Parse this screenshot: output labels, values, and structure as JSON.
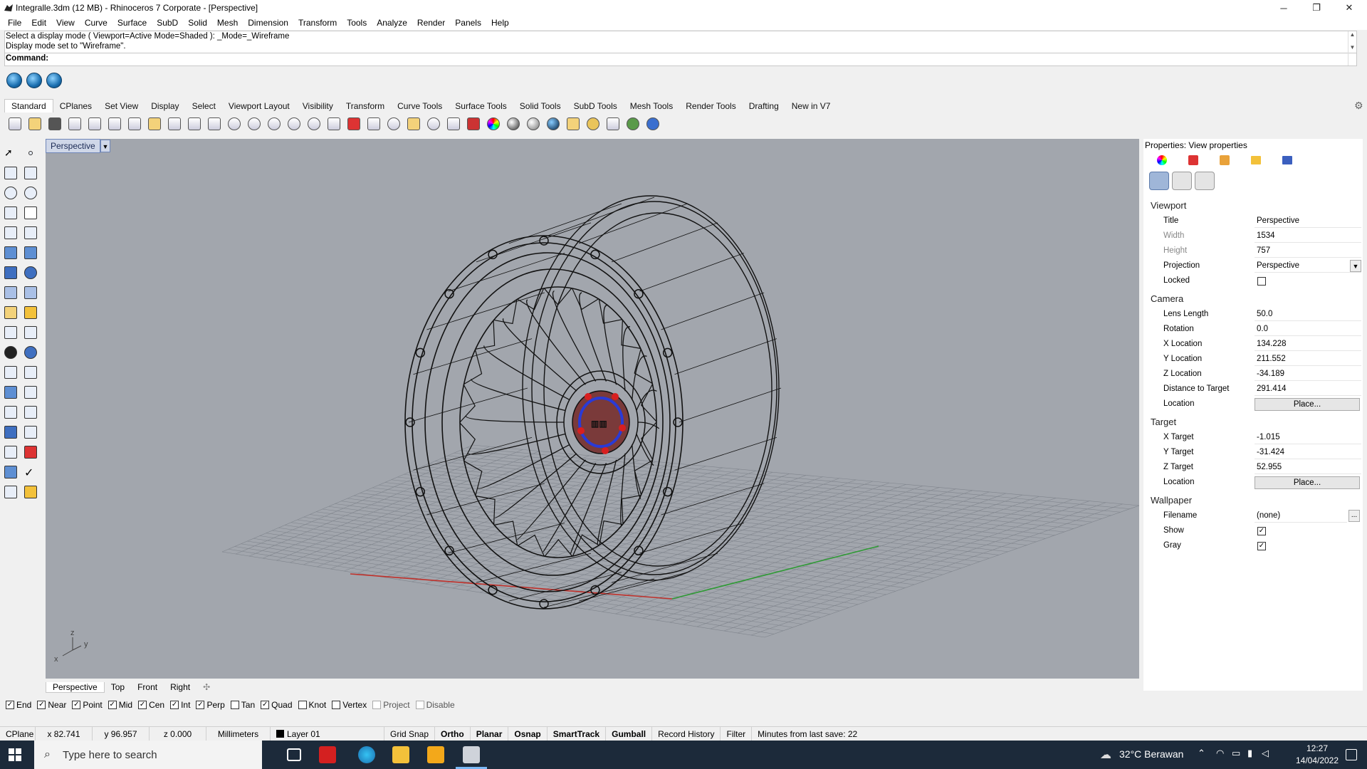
{
  "window": {
    "title": "Integralle.3dm (12 MB) - Rhinoceros 7 Corporate - [Perspective]",
    "minimize": "─",
    "maximize": "❐",
    "close": "✕"
  },
  "menu": [
    "File",
    "Edit",
    "View",
    "Curve",
    "Surface",
    "SubD",
    "Solid",
    "Mesh",
    "Dimension",
    "Transform",
    "Tools",
    "Analyze",
    "Render",
    "Panels",
    "Help"
  ],
  "command": {
    "history1": "Select a display mode ( Viewport=Active  Mode=Shaded ): _Mode=_Wireframe",
    "history2": "Display mode set to \"Wireframe\".",
    "prompt": "Command:"
  },
  "toolbar_tabs": [
    "Standard",
    "CPlanes",
    "Set View",
    "Display",
    "Select",
    "Viewport Layout",
    "Visibility",
    "Transform",
    "Curve Tools",
    "Surface Tools",
    "Solid Tools",
    "SubD Tools",
    "Mesh Tools",
    "Render Tools",
    "Drafting",
    "New in V7"
  ],
  "viewport": {
    "label": "Perspective",
    "caret": "▼",
    "axes": {
      "x": "x",
      "y": "y",
      "z": "z"
    }
  },
  "viewport_tabs": [
    "Perspective",
    "Top",
    "Front",
    "Right",
    "✣"
  ],
  "osnaps": [
    {
      "label": "End",
      "checked": true
    },
    {
      "label": "Near",
      "checked": true
    },
    {
      "label": "Point",
      "checked": true
    },
    {
      "label": "Mid",
      "checked": true
    },
    {
      "label": "Cen",
      "checked": true
    },
    {
      "label": "Int",
      "checked": true
    },
    {
      "label": "Perp",
      "checked": true
    },
    {
      "label": "Tan",
      "checked": false
    },
    {
      "label": "Quad",
      "checked": true
    },
    {
      "label": "Knot",
      "checked": false
    },
    {
      "label": "Vertex",
      "checked": false
    },
    {
      "label": "Project",
      "checked": false
    },
    {
      "label": "Disable",
      "checked": false
    }
  ],
  "status": {
    "cplane": "CPlane",
    "x": "x 82.741",
    "y": "y 96.957",
    "z": "z 0.000",
    "units": "Millimeters",
    "layer": "Layer 01",
    "grid_snap": "Grid Snap",
    "ortho": "Ortho",
    "planar": "Planar",
    "osnap": "Osnap",
    "smarttrack": "SmartTrack",
    "gumball": "Gumball",
    "record_history": "Record History",
    "filter": "Filter",
    "autosave": "Minutes from last save: 22"
  },
  "properties": {
    "title": "Properties: View properties",
    "sections": {
      "viewport": "Viewport",
      "camera": "Camera",
      "target": "Target",
      "wallpaper": "Wallpaper"
    },
    "viewport_rows": {
      "title_label": "Title",
      "title_value": "Perspective",
      "width_label": "Width",
      "width_value": "1534",
      "height_label": "Height",
      "height_value": "757",
      "projection_label": "Projection",
      "projection_value": "Perspective",
      "locked_label": "Locked"
    },
    "camera_rows": {
      "lens_label": "Lens Length",
      "lens_value": "50.0",
      "rotation_label": "Rotation",
      "rotation_value": "0.0",
      "xloc_label": "X Location",
      "xloc_value": "134.228",
      "yloc_label": "Y Location",
      "yloc_value": "211.552",
      "zloc_label": "Z Location",
      "zloc_value": "-34.189",
      "dist_label": "Distance to Target",
      "dist_value": "291.414",
      "location_label": "Location",
      "place": "Place..."
    },
    "target_rows": {
      "xt_label": "X Target",
      "xt_value": "-1.015",
      "yt_label": "Y Target",
      "yt_value": "-31.424",
      "zt_label": "Z Target",
      "zt_value": "52.955",
      "location_label": "Location",
      "place": "Place..."
    },
    "wallpaper_rows": {
      "filename_label": "Filename",
      "filename_value": "(none)",
      "ellipsis": "...",
      "show_label": "Show",
      "show_checked": true,
      "gray_label": "Gray",
      "gray_checked": true
    }
  },
  "taskbar": {
    "search_placeholder": "Type here to search",
    "weather": "32°C  Berawan",
    "time": "12:27",
    "date": "14/04/2022"
  },
  "colors": {
    "viewport_bg": "#a2a6ad",
    "axis_x": "#c0302a",
    "axis_y": "#2f9a35",
    "accent_blue": "#2a3ad6",
    "accent_red": "#d81f1f"
  }
}
